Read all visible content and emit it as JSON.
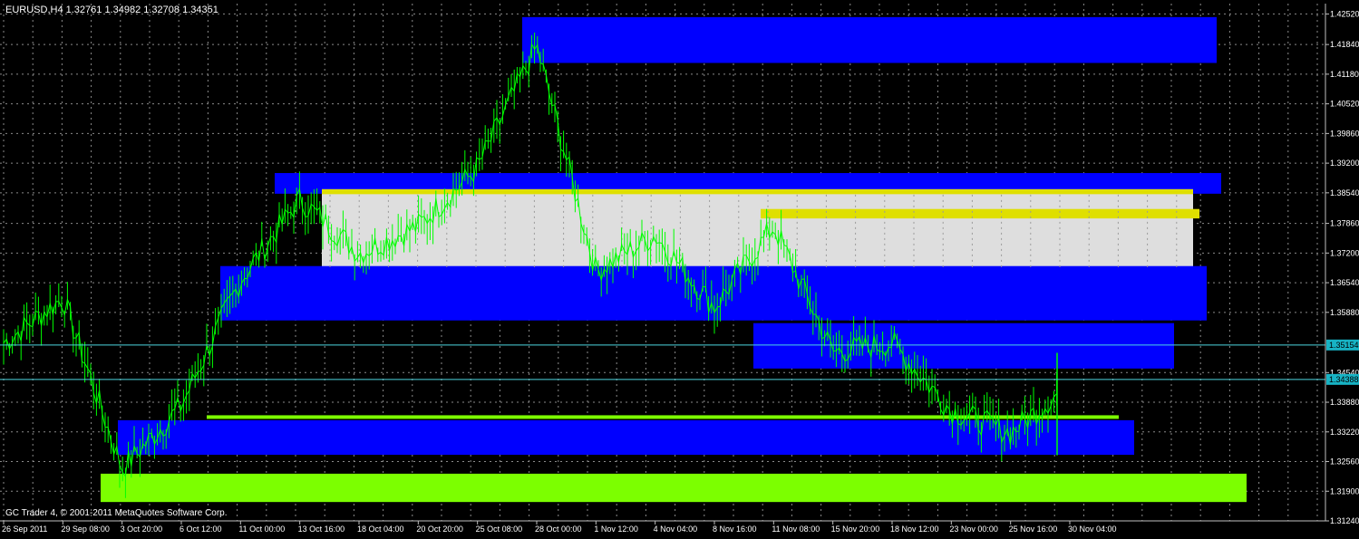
{
  "window": {
    "symbol_title": "EURUSD,H4  1.32761 1.34982 1.32708 1.34351",
    "copyright": "GC Trader 4, © 2001-2011 MetaQuotes Software Corp."
  },
  "colors": {
    "background": "#000000",
    "grid": "#8a8a8a",
    "axis": "#c0c0c0",
    "text": "#ffffff",
    "candles": "#00ff00",
    "zone_blue": "#0000ff",
    "zone_green": "#7cff00",
    "zone_gray": "#dedede",
    "zone_yellow": "#dfdf00",
    "hline_cyan": "#4dd6e0",
    "tag_cyan": "#17b3c4"
  },
  "chart_data": {
    "type": "line",
    "title": "EURUSD,H4  1.32761 1.34982 1.32708 1.34351",
    "ylim": [
      1.3124,
      1.4275
    ],
    "grid": true,
    "y_ticks": [
      1.4252,
      1.4184,
      1.4118,
      1.4052,
      1.3986,
      1.392,
      1.3854,
      1.3786,
      1.372,
      1.3654,
      1.3588,
      1.3454,
      1.3388,
      1.3322,
      1.3256,
      1.319,
      1.3124
    ],
    "y_tick_labels": [
      "1.42520",
      "1.41840",
      "1.41180",
      "1.40520",
      "1.39860",
      "1.39200",
      "1.38540",
      "1.37860",
      "1.37200",
      "1.36540",
      "1.35880",
      "1.34540",
      "1.33880",
      "1.33220",
      "1.32560",
      "1.31900",
      "1.31240"
    ],
    "x_ticks": [
      "26 Sep 2011",
      "29 Sep 08:00",
      "3 Oct 20:00",
      "6 Oct 12:00",
      "11 Oct 00:00",
      "13 Oct 16:00",
      "18 Oct 04:00",
      "20 Oct 20:00",
      "25 Oct 08:00",
      "28 Oct 00:00",
      "1 Nov 12:00",
      "4 Nov 04:00",
      "8 Nov 16:00",
      "11 Nov 08:00",
      "15 Nov 20:00",
      "18 Nov 12:00",
      "23 Nov 00:00",
      "25 Nov 16:00",
      "30 Nov 04:00"
    ],
    "series": [
      {
        "x": [
          "26 Sep 2011",
          "29 Sep 08:00",
          "3 Oct 20:00",
          "6 Oct 12:00",
          "11 Oct 00:00",
          "13 Oct 16:00",
          "18 Oct 04:00",
          "20 Oct 20:00",
          "25 Oct 08:00",
          "28 Oct 00:00",
          "1 Nov 12:00",
          "4 Nov 04:00",
          "8 Nov 16:00",
          "11 Nov 08:00",
          "15 Nov 20:00",
          "18 Nov 12:00",
          "23 Nov 00:00",
          "25 Nov 16:00",
          "30 Nov 04:00"
        ],
        "y": [
          1.352,
          1.362,
          1.324,
          1.338,
          1.366,
          1.384,
          1.372,
          1.378,
          1.391,
          1.418,
          1.368,
          1.376,
          1.36,
          1.378,
          1.35,
          1.352,
          1.337,
          1.332,
          1.343
        ]
      }
    ],
    "zones": [
      {
        "color": "blue",
        "y_top": 1.4245,
        "y_bottom": 1.4143
      },
      {
        "color": "blue",
        "y_top": 1.3898,
        "y_bottom": 1.3852
      },
      {
        "color": "gray",
        "y_top": 1.3862,
        "y_bottom": 1.3675
      },
      {
        "color": "yellow",
        "y_top": 1.3862,
        "y_bottom": 1.3851
      },
      {
        "color": "yellow",
        "y_top": 1.3818,
        "y_bottom": 1.3797
      },
      {
        "color": "yellow",
        "y_top": 1.369,
        "y_bottom": 1.3675
      },
      {
        "color": "blue",
        "y_top": 1.3691,
        "y_bottom": 1.357
      },
      {
        "color": "blue",
        "y_top": 1.3564,
        "y_bottom": 1.3463
      },
      {
        "color": "blue",
        "y_top": 1.3348,
        "y_bottom": 1.3271
      },
      {
        "color": "green",
        "y_top": 1.3359,
        "y_bottom": 1.3351
      },
      {
        "color": "green",
        "y_top": 1.3229,
        "y_bottom": 1.3166
      }
    ],
    "hlines": [
      {
        "value": 1.35154,
        "label": "1.35154"
      },
      {
        "value": 1.34388,
        "label": "1.34388"
      }
    ]
  }
}
